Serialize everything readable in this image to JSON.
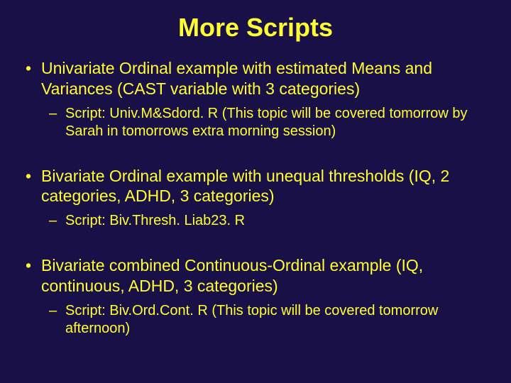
{
  "title": "More Scripts",
  "items": [
    {
      "main": "Univariate Ordinal example with estimated Means and Variances (CAST variable with 3 categories)",
      "sub": "Script: Univ.M&Sdord. R (This topic will be covered tomorrow by Sarah in tomorrows extra morning session)"
    },
    {
      "main": "Bivariate Ordinal example with unequal thresholds (IQ, 2 categories, ADHD, 3 categories)",
      "sub": "Script: Biv.Thresh. Liab23. R"
    },
    {
      "main": "Bivariate combined Continuous-Ordinal example (IQ, continuous, ADHD, 3 categories)",
      "sub": "Script: Biv.Ord.Cont. R (This topic will be covered tomorrow afternoon)"
    }
  ]
}
